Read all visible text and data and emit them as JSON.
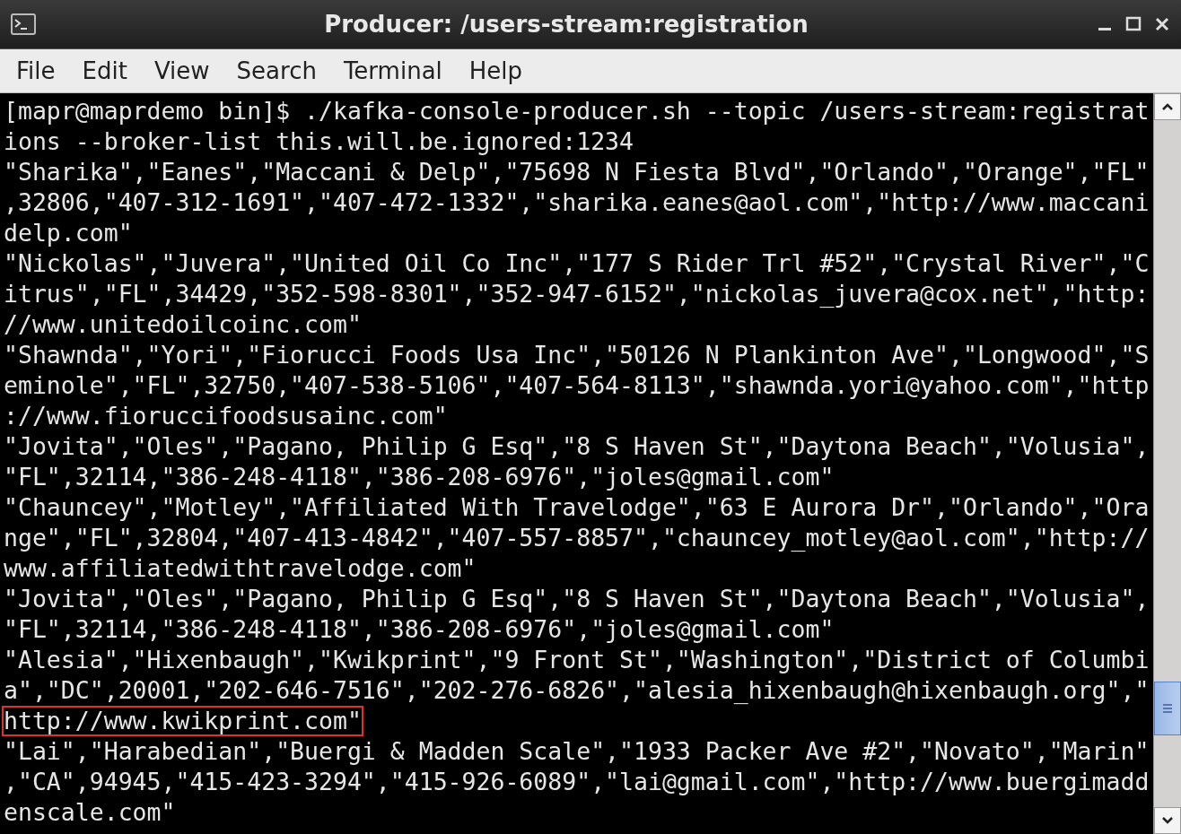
{
  "window": {
    "title": "Producer: /users-stream:registration"
  },
  "menu": [
    {
      "label": "File"
    },
    {
      "label": "Edit"
    },
    {
      "label": "View"
    },
    {
      "label": "Search"
    },
    {
      "label": "Terminal"
    },
    {
      "label": "Help"
    }
  ],
  "terminal": {
    "lines": [
      {
        "text": "[mapr@maprdemo bin]$ ./kafka-console-producer.sh --topic /users-stream:registrat",
        "highlighted": false
      },
      {
        "text": "ions --broker-list this.will.be.ignored:1234",
        "highlighted": false
      },
      {
        "text": "\"Sharika\",\"Eanes\",\"Maccani & Delp\",\"75698 N Fiesta Blvd\",\"Orlando\",\"Orange\",\"FL\"",
        "highlighted": false
      },
      {
        "text": ",32806,\"407-312-1691\",\"407-472-1332\",\"sharika.eanes@aol.com\",\"http://www.maccani",
        "highlighted": false
      },
      {
        "text": "delp.com\"",
        "highlighted": false
      },
      {
        "text": "\"Nickolas\",\"Juvera\",\"United Oil Co Inc\",\"177 S Rider Trl #52\",\"Crystal River\",\"C",
        "highlighted": false
      },
      {
        "text": "itrus\",\"FL\",34429,\"352-598-8301\",\"352-947-6152\",\"nickolas_juvera@cox.net\",\"http:",
        "highlighted": false
      },
      {
        "text": "//www.unitedoilcoinc.com\"",
        "highlighted": false
      },
      {
        "text": "\"Shawnda\",\"Yori\",\"Fiorucci Foods Usa Inc\",\"50126 N Plankinton Ave\",\"Longwood\",\"S",
        "highlighted": false
      },
      {
        "text": "eminole\",\"FL\",32750,\"407-538-5106\",\"407-564-8113\",\"shawnda.yori@yahoo.com\",\"http",
        "highlighted": false
      },
      {
        "text": "://www.fioruccifoodsusainc.com\"",
        "highlighted": false
      },
      {
        "text": "\"Jovita\",\"Oles\",\"Pagano, Philip G Esq\",\"8 S Haven St\",\"Daytona Beach\",\"Volusia\",",
        "highlighted": false
      },
      {
        "text": "\"FL\",32114,\"386-248-4118\",\"386-208-6976\",\"joles@gmail.com\"",
        "highlighted": false
      },
      {
        "text": "\"Chauncey\",\"Motley\",\"Affiliated With Travelodge\",\"63 E Aurora Dr\",\"Orlando\",\"Ora",
        "highlighted": false
      },
      {
        "text": "nge\",\"FL\",32804,\"407-413-4842\",\"407-557-8857\",\"chauncey_motley@aol.com\",\"http://",
        "highlighted": false
      },
      {
        "text": "www.affiliatedwithtravelodge.com\"",
        "highlighted": false
      },
      {
        "text": "\"Jovita\",\"Oles\",\"Pagano, Philip G Esq\",\"8 S Haven St\",\"Daytona Beach\",\"Volusia\",",
        "highlighted": false
      },
      {
        "text": "\"FL\",32114,\"386-248-4118\",\"386-208-6976\",\"joles@gmail.com\"",
        "highlighted": false
      },
      {
        "text": "\"Alesia\",\"Hixenbaugh\",\"Kwikprint\",\"9 Front St\",\"Washington\",\"District of Columbi",
        "highlighted": false
      },
      {
        "text": "a\",\"DC\",20001,\"202-646-7516\",\"202-276-6826\",\"alesia_hixenbaugh@hixenbaugh.org\",\"",
        "highlighted": false
      },
      {
        "text": "http://www.kwikprint.com\"",
        "highlighted": true
      },
      {
        "text": "\"Lai\",\"Harabedian\",\"Buergi & Madden Scale\",\"1933 Packer Ave #2\",\"Novato\",\"Marin\"",
        "highlighted": false
      },
      {
        "text": ",\"CA\",94945,\"415-423-3294\",\"415-926-6089\",\"lai@gmail.com\",\"http://www.buergimadd",
        "highlighted": false
      },
      {
        "text": "enscale.com\"",
        "highlighted": false
      }
    ]
  }
}
